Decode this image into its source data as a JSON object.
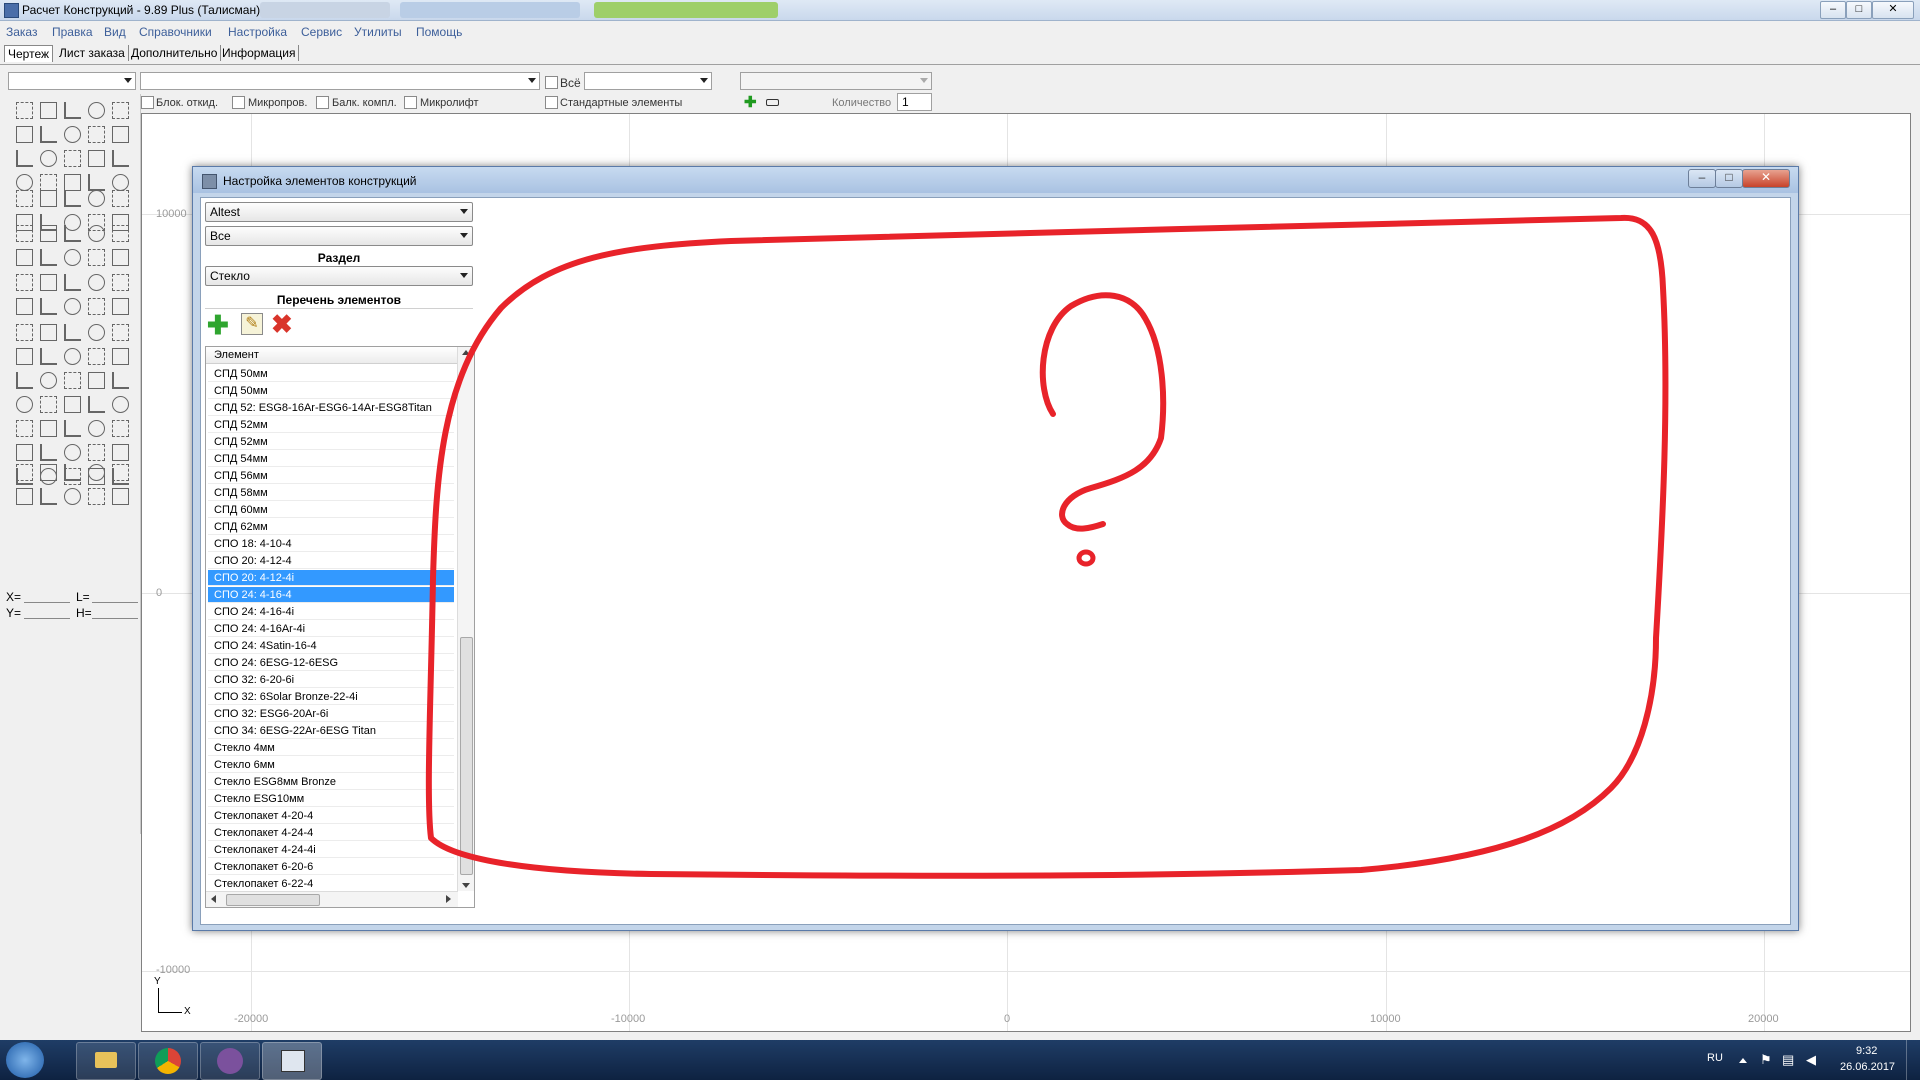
{
  "window": {
    "title": "Расчет Конструкций - 9.89 Plus (Талисман)"
  },
  "menu": [
    "Заказ",
    "Правка",
    "Вид",
    "Справочники",
    "Настройка",
    "Сервис",
    "Утилиты",
    "Помощь"
  ],
  "tabs": [
    "Чертеж",
    "Лист заказа",
    "Дополнительно",
    "Информация"
  ],
  "toolbar": {
    "all_label": "Всё",
    "checks": [
      "Блок. откид.",
      "Микропров.",
      "Балк. компл.",
      "Микролифт"
    ],
    "standard_elements": "Стандартные элементы",
    "quantity_label": "Количество",
    "quantity_value": "1"
  },
  "coords": {
    "x_label": "X=",
    "l_label": "L=",
    "y_label": "Y=",
    "h_label": "H="
  },
  "axis": {
    "y_ticks": [
      "10000",
      "0",
      "-10000"
    ],
    "x_ticks": [
      "-20000",
      "-10000",
      "0",
      "10000",
      "20000"
    ],
    "y_name": "Y",
    "x_name": "X"
  },
  "dialog": {
    "title": "Настройка элементов конструкций",
    "combo1": "Altest",
    "combo2": "Все",
    "section_label": "Раздел",
    "section_value": "Стекло",
    "list_label": "Перечень элементов",
    "column_header": "Элемент",
    "items": [
      {
        "name": "СПД 50мм",
        "selected": false
      },
      {
        "name": "СПД 50мм",
        "selected": false
      },
      {
        "name": "СПД 52: ESG8-16Ar-ESG6-14Ar-ESG8Titan",
        "selected": false
      },
      {
        "name": "СПД 52мм",
        "selected": false
      },
      {
        "name": "СПД 52мм",
        "selected": false
      },
      {
        "name": "СПД 54мм",
        "selected": false
      },
      {
        "name": "СПД 56мм",
        "selected": false
      },
      {
        "name": "СПД 58мм",
        "selected": false
      },
      {
        "name": "СПД 60мм",
        "selected": false
      },
      {
        "name": "СПД 62мм",
        "selected": false
      },
      {
        "name": "СПО 18: 4-10-4",
        "selected": false
      },
      {
        "name": "СПО 20: 4-12-4",
        "selected": false
      },
      {
        "name": "СПО 20: 4-12-4i",
        "selected": true
      },
      {
        "name": "СПО 24: 4-16-4",
        "selected": true
      },
      {
        "name": "СПО 24: 4-16-4i",
        "selected": false
      },
      {
        "name": "СПО 24: 4-16Ar-4i",
        "selected": false
      },
      {
        "name": "СПО 24: 4Satin-16-4",
        "selected": false
      },
      {
        "name": "СПО 24: 6ESG-12-6ESG",
        "selected": false
      },
      {
        "name": "СПО 32: 6-20-6i",
        "selected": false
      },
      {
        "name": "СПО 32: 6Solar Bronze-22-4i",
        "selected": false
      },
      {
        "name": "СПО 32: ESG6-20Ar-6i",
        "selected": false
      },
      {
        "name": "СПО 34: 6ESG-22Ar-6ESG Titan",
        "selected": false
      },
      {
        "name": "Стекло 4мм",
        "selected": false
      },
      {
        "name": "Стекло 6мм",
        "selected": false
      },
      {
        "name": "Стекло ESG8мм Bronze",
        "selected": false
      },
      {
        "name": "Стекло ESG10мм",
        "selected": false
      },
      {
        "name": "Стеклопакет 4-20-4",
        "selected": false
      },
      {
        "name": "Стеклопакет 4-24-4",
        "selected": false
      },
      {
        "name": "Стеклопакет 4-24-4i",
        "selected": false
      },
      {
        "name": "Стеклопакет 6-20-6",
        "selected": false
      },
      {
        "name": "Стеклопакет 6-22-4",
        "selected": false
      }
    ],
    "annotation_symbol": "?",
    "annotation_color": "#e8232a"
  },
  "taskbar": {
    "lang": "RU",
    "time": "9:32",
    "date": "26.06.2017"
  },
  "colors": {
    "selection": "#3399ff",
    "taskbar": "#163057",
    "menu_text": "#3d5f9a"
  }
}
